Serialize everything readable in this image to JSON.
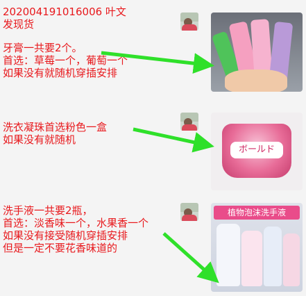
{
  "messages": [
    {
      "lines": [
        "202004191016006 叶文",
        "发现货"
      ],
      "lines2": [
        "牙膏一共要2个。",
        "首选：草莓一个，葡萄一个",
        "如果没有就随机穿插安排"
      ]
    },
    {
      "lines": [
        "洗衣凝珠首选粉色一盒",
        "如果没有就随机"
      ]
    },
    {
      "lines": [
        "洗手液一共要2瓶，",
        "首选：淡香味一个，水果香一个",
        "如果没有接受随机穿插安排",
        "但是一定不要花香味道的"
      ]
    }
  ],
  "product_labels": {
    "detergent": "ボールド",
    "handsoap": "植物泡沫洗手液"
  },
  "colors": {
    "text_red": "#e8191d",
    "arrow_green": "#2fe02a"
  }
}
